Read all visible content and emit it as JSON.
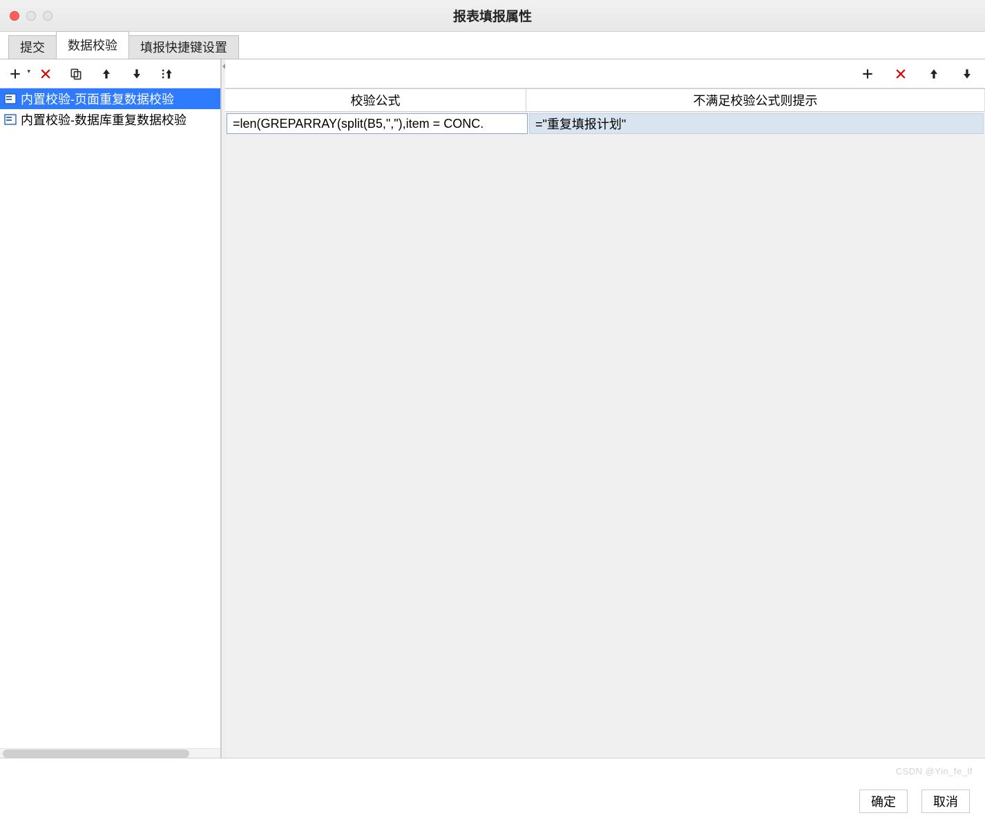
{
  "window": {
    "title": "报表填报属性"
  },
  "tabs": [
    {
      "label": "提交",
      "active": false
    },
    {
      "label": "数据校验",
      "active": true
    },
    {
      "label": "填报快捷键设置",
      "active": false
    }
  ],
  "left": {
    "toolbar": {
      "add": "add-icon",
      "delete": "delete-icon",
      "copy": "copy-icon",
      "moveUp": "arrow-up-icon",
      "moveDown": "arrow-down-icon",
      "sort": "sort-icon"
    },
    "items": [
      {
        "label": "内置校验-页面重复数据校验",
        "selected": true
      },
      {
        "label": "内置校验-数据库重复数据校验",
        "selected": false
      }
    ]
  },
  "right": {
    "toolbar": {
      "add": "plus-icon",
      "delete": "delete-icon",
      "moveUp": "arrow-up-icon",
      "moveDown": "arrow-down-icon"
    },
    "columns": {
      "formula": "校验公式",
      "tip": "不满足校验公式则提示"
    },
    "rows": [
      {
        "formula": "=len(GREPARRAY(split(B5,\",\"),item = CONC.",
        "tip": "=\"重复填报计划\""
      }
    ]
  },
  "footer": {
    "ok": "确定",
    "cancel": "取消"
  },
  "watermark": "CSDN @Yin_fe_lf"
}
